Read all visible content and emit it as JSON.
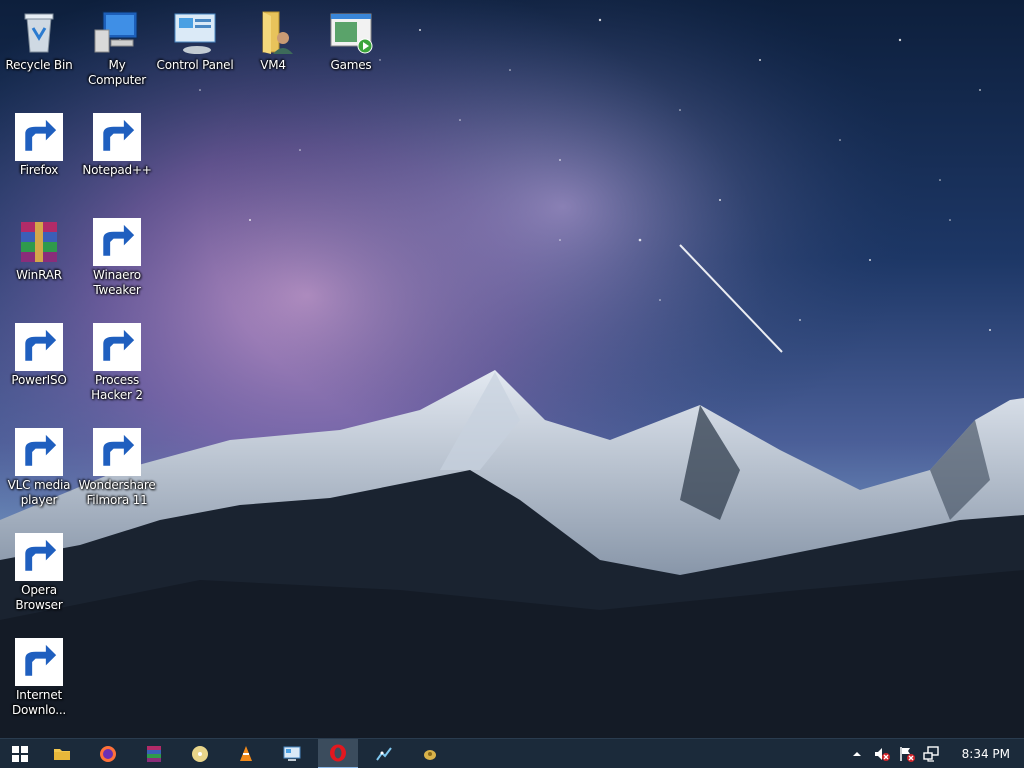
{
  "desktop": {
    "icons": [
      {
        "label": "Recycle Bin"
      },
      {
        "label": "My Computer"
      },
      {
        "label": "Control Panel"
      },
      {
        "label": "VM4"
      },
      {
        "label": "Games"
      },
      {
        "label": "Firefox"
      },
      {
        "label": "Notepad++"
      },
      {
        "label": "WinRAR"
      },
      {
        "label": "Winaero\nTweaker"
      },
      {
        "label": "PowerISO"
      },
      {
        "label": "Process\nHacker 2"
      },
      {
        "label": "VLC media\nplayer"
      },
      {
        "label": "Wondershare\nFilmora 11"
      },
      {
        "label": "Opera\nBrowser"
      },
      {
        "label": "Internet\nDownlo..."
      }
    ]
  },
  "taskbar": {
    "clock": "8:34 PM",
    "pinned": [
      "start",
      "file-explorer",
      "firefox",
      "winrar",
      "poweriso",
      "vlc",
      "control-panel",
      "opera",
      "process-hacker",
      "media-app"
    ],
    "active": "opera"
  },
  "colors": {
    "taskbar_bg": "#1b2a3a",
    "active_tab": "#3b4c5d"
  }
}
